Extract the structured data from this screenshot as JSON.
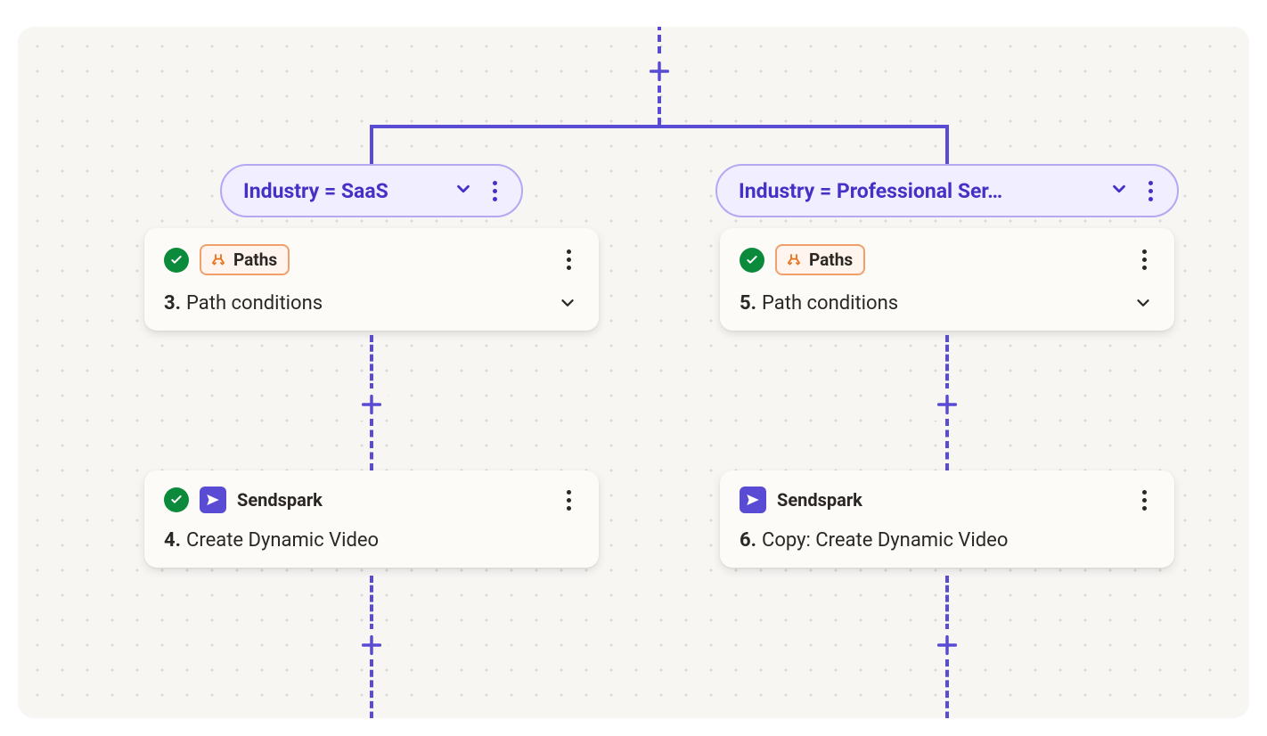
{
  "branches": [
    {
      "pill_label": "Industry = SaaS",
      "cards": [
        {
          "has_check": true,
          "tag_label": "Paths",
          "step_number": "3.",
          "step_title": "Path conditions",
          "expandable": true
        },
        {
          "has_check": true,
          "app_name": "Sendspark",
          "step_number": "4.",
          "step_title": "Create Dynamic Video",
          "expandable": false
        }
      ]
    },
    {
      "pill_label": "Industry = Professional Ser…",
      "cards": [
        {
          "has_check": true,
          "tag_label": "Paths",
          "step_number": "5.",
          "step_title": "Path conditions",
          "expandable": true
        },
        {
          "has_check": false,
          "app_name": "Sendspark",
          "step_number": "6.",
          "step_title": "Copy: Create Dynamic Video",
          "expandable": false
        }
      ]
    }
  ]
}
